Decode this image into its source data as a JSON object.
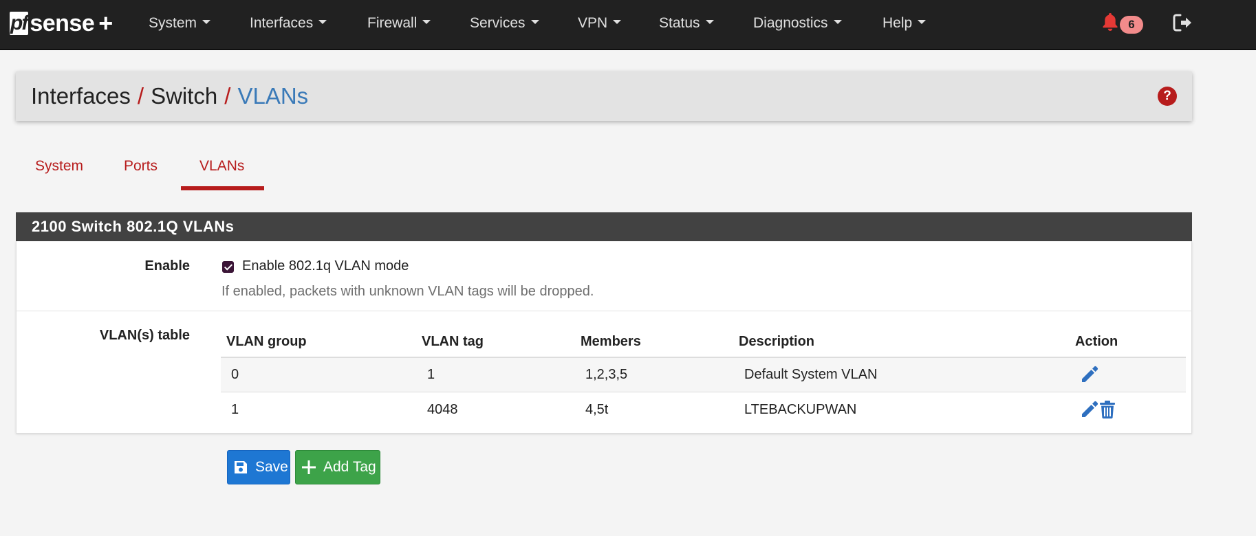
{
  "navbar": {
    "brand": {
      "pf": "pf",
      "sense": "sense",
      "plus": "+"
    },
    "menu": [
      {
        "label": "System"
      },
      {
        "label": "Interfaces"
      },
      {
        "label": "Firewall"
      },
      {
        "label": "Services"
      },
      {
        "label": "VPN"
      },
      {
        "label": "Status"
      },
      {
        "label": "Diagnostics"
      },
      {
        "label": "Help"
      }
    ],
    "notifications_count": "6"
  },
  "breadcrumb": {
    "items": [
      "Interfaces",
      "Switch",
      "VLANs"
    ],
    "separator": "/"
  },
  "help_icon": "?",
  "tabs": [
    {
      "label": "System",
      "active": false
    },
    {
      "label": "Ports",
      "active": false
    },
    {
      "label": "VLANs",
      "active": true
    }
  ],
  "section": {
    "title": "2100 Switch 802.1Q VLANs",
    "enable": {
      "label": "Enable",
      "checkbox_label": "Enable 802.1q VLAN mode",
      "checked": true,
      "help": "If enabled, packets with unknown VLAN tags will be dropped."
    },
    "vlan_table": {
      "label": "VLAN(s) table",
      "columns": [
        "VLAN group",
        "VLAN tag",
        "Members",
        "Description",
        "Action"
      ],
      "rows": [
        {
          "group": "0",
          "tag": "1",
          "members": "1,2,3,5",
          "description": "Default System VLAN",
          "actions": [
            "edit"
          ]
        },
        {
          "group": "1",
          "tag": "4048",
          "members": "4,5t",
          "description": "LTEBACKUPWAN",
          "actions": [
            "edit",
            "delete"
          ]
        }
      ]
    }
  },
  "buttons": {
    "save": "Save",
    "add_tag": "Add Tag"
  },
  "colors": {
    "navbar": "#212121",
    "accent_red": "#b71c1c",
    "link_blue": "#3a7ab8",
    "save_blue": "#1e77d3",
    "add_green": "#3da349",
    "icon_blue": "#2e6fbf"
  },
  "icons": [
    "bell-icon",
    "logout-icon",
    "help-icon",
    "edit-icon",
    "trash-icon",
    "save-icon",
    "plus-icon"
  ]
}
